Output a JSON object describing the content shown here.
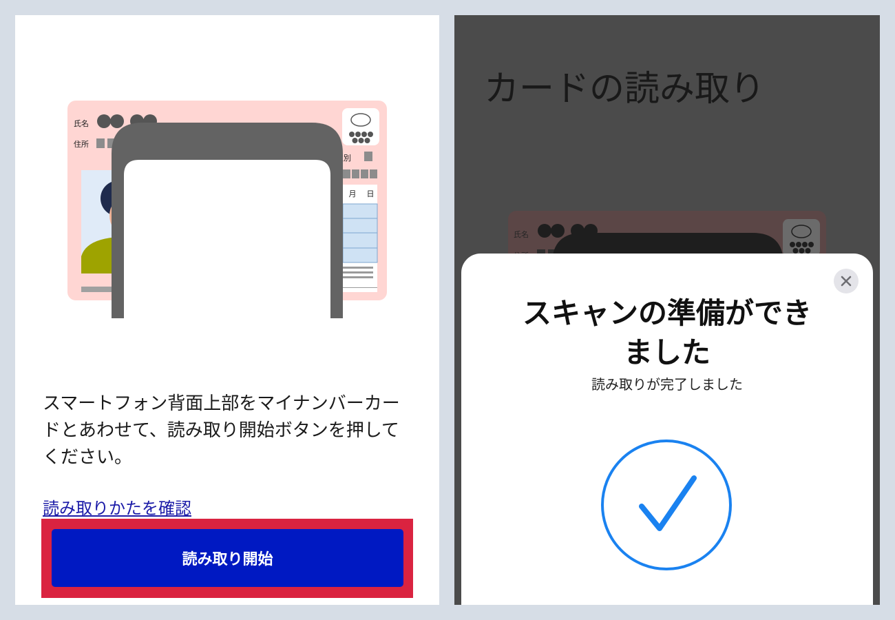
{
  "left_screen": {
    "card": {
      "name_label": "氏名",
      "address_label": "住所",
      "sex_label": "性別",
      "month_label": "月",
      "day_label": "日",
      "chip_icon": "card-chip-icon",
      "photo_icon": "portrait-icon"
    },
    "phone_icon": "smartphone-icon",
    "instruction": "スマートフォン背面上部をマイナンバーカードとあわせて、読み取り開始ボタンを押してください。",
    "help_link": "読み取りかたを確認",
    "start_button": "読み取り開始"
  },
  "right_screen": {
    "title": "カードの読み取り",
    "card": {
      "name_label": "氏名",
      "address_label": "住所"
    },
    "scan_sheet": {
      "title": "スキャンの準備ができました",
      "subtitle": "読み取りが完了しました",
      "close_icon": "close-icon",
      "status_icon": "checkmark-circle-icon"
    }
  },
  "colors": {
    "page_background": "#d6dde6",
    "start_button": "#0019c2",
    "highlight_frame": "#da2340",
    "link": "#1c1ca8",
    "card_pink": "#ffd6d3",
    "dimmed_overlay": "#4b4b4b",
    "check_blue": "#1a82f0"
  }
}
